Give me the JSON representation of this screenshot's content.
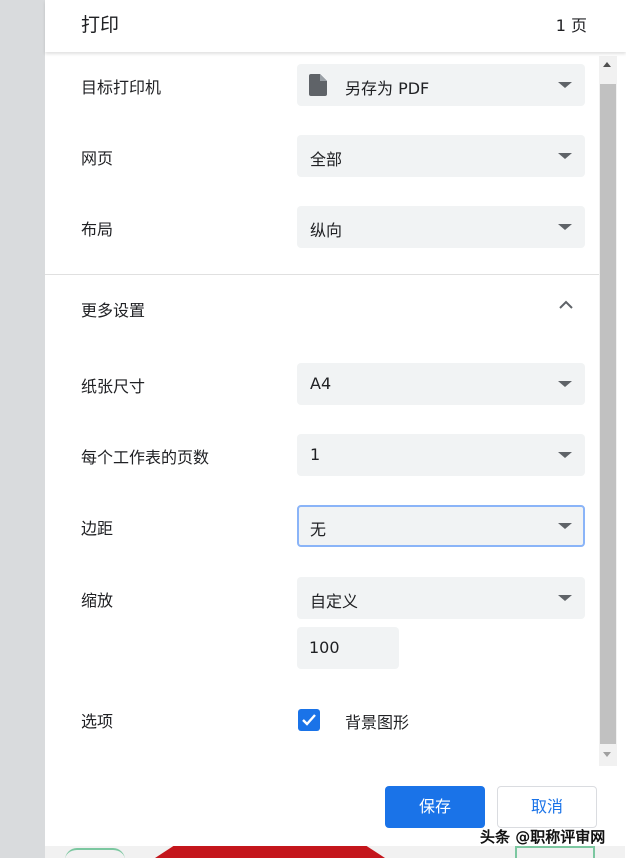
{
  "header": {
    "title": "打印",
    "pages": "1 页"
  },
  "settings": {
    "destination": {
      "label": "目标打印机",
      "value": "另存为 PDF"
    },
    "pages": {
      "label": "网页",
      "value": "全部"
    },
    "layout": {
      "label": "布局",
      "value": "纵向"
    },
    "more_settings": {
      "label": "更多设置"
    },
    "paper_size": {
      "label": "纸张尺寸",
      "value": "A4"
    },
    "pages_per_sheet": {
      "label": "每个工作表的页数",
      "value": "1"
    },
    "margins": {
      "label": "边距",
      "value": "无"
    },
    "scale": {
      "label": "缩放",
      "value": "自定义",
      "custom_value": "100"
    },
    "options": {
      "label": "选项",
      "checkbox_label": "背景图形",
      "checked": true
    }
  },
  "buttons": {
    "save": "保存",
    "cancel": "取消"
  },
  "watermark": "头条 @职称评审网",
  "colors": {
    "accent": "#1a73e8",
    "select_bg": "#f1f3f4",
    "focus_border": "#8ab4f8"
  },
  "icons": [
    "document-icon",
    "chevron-up-icon",
    "dropdown-caret-icon",
    "checkmark-icon"
  ]
}
